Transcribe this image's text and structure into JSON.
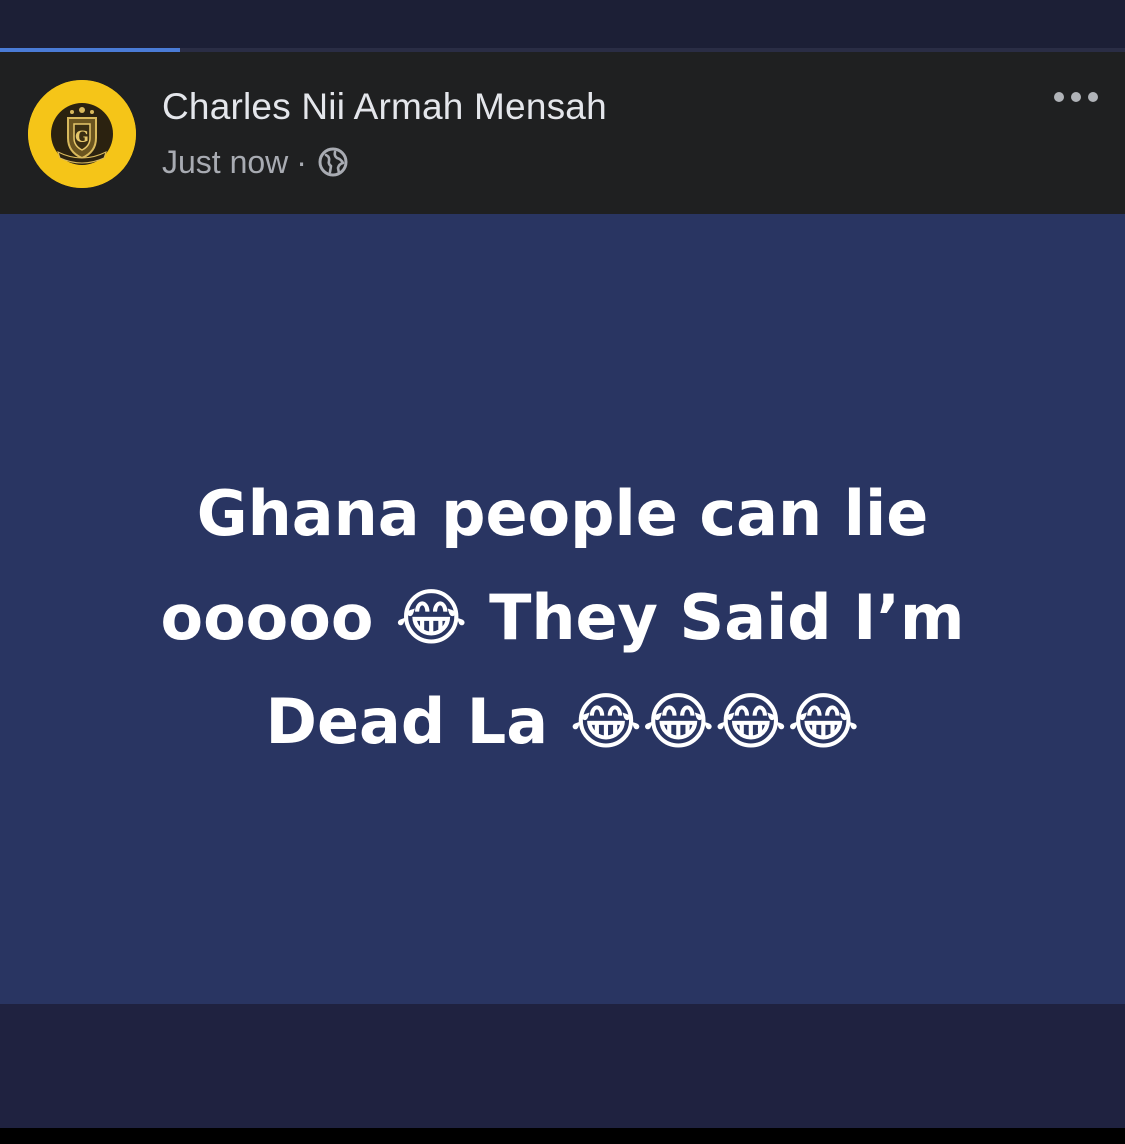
{
  "progress": {
    "fraction": 0.16,
    "color": "#4a7bd6"
  },
  "post": {
    "author": "Charles Nii Armah Mensah",
    "timestamp": "Just now",
    "separator": "·",
    "privacy_icon": "globe-icon",
    "more_icon": "more-options-icon",
    "avatar": {
      "icon": "crest-logo",
      "background": "#f5c518"
    },
    "background_color": "#293562",
    "text": "Ghana people can lie ooooo 😂 They Said I’m Dead La 😂😂😂😂"
  }
}
